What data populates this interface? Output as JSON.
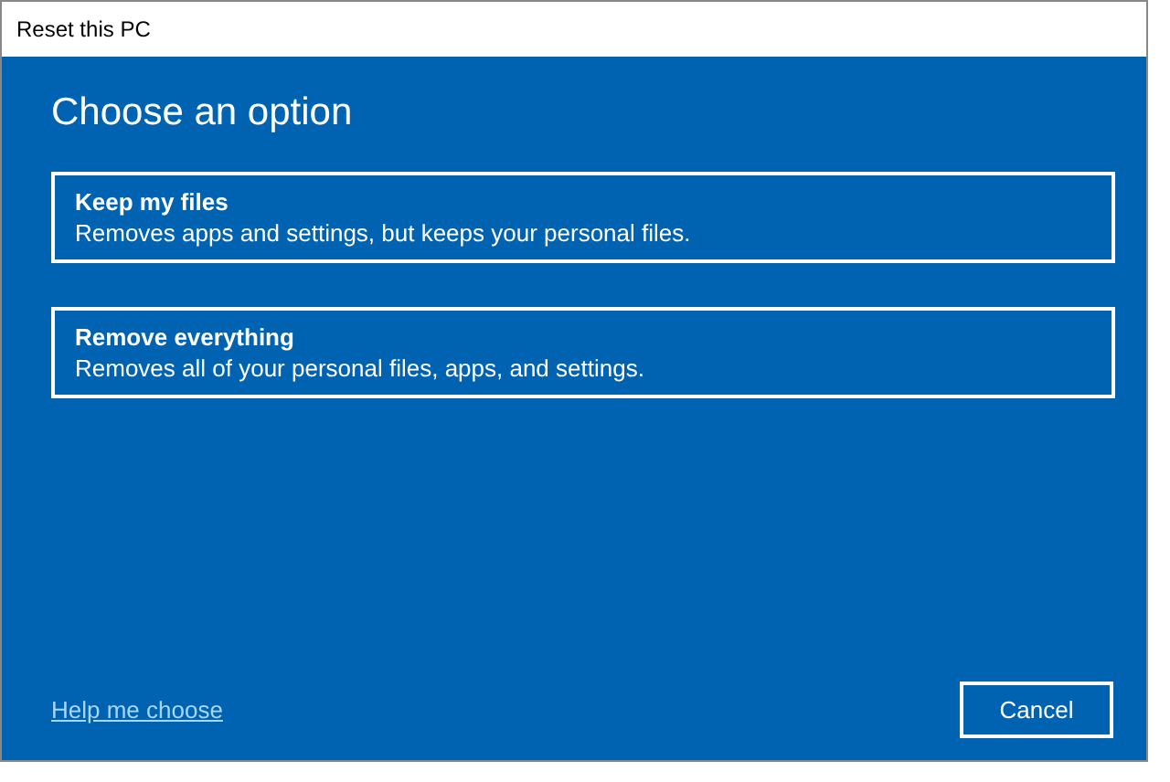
{
  "window": {
    "title": "Reset this PC"
  },
  "heading": "Choose an option",
  "options": [
    {
      "title": "Keep my files",
      "description": "Removes apps and settings, but keeps your personal files."
    },
    {
      "title": "Remove everything",
      "description": "Removes all of your personal files, apps, and settings."
    }
  ],
  "help_link": "Help me choose",
  "buttons": [
    "Cancel"
  ]
}
